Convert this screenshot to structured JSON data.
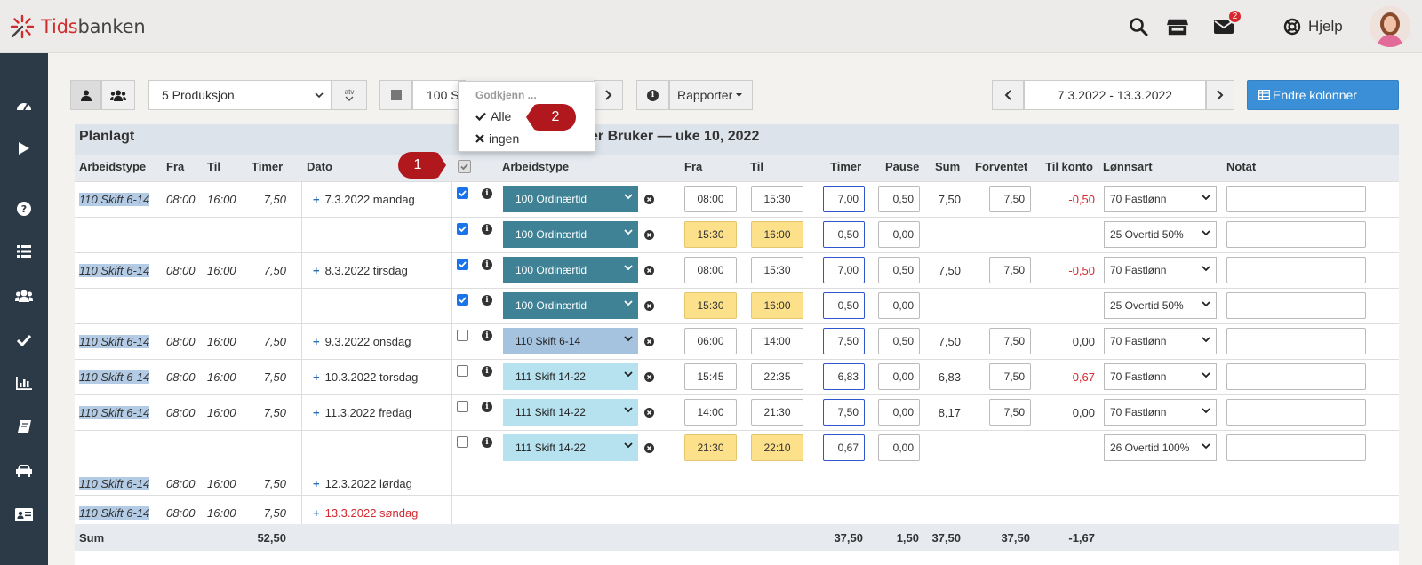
{
  "brand": {
    "name_part1": "Tids",
    "name_part2": "banken"
  },
  "topbar": {
    "help_label": "Hjelp",
    "mail_badge": "2"
  },
  "toolbar": {
    "department": "5 Produksjon",
    "attest": "atv",
    "employee_partial": "100 S",
    "reports": "Rapporter",
    "date_range": "7.3.2022 - 13.3.2022",
    "change_columns": "Endre kolonner"
  },
  "dropdown": {
    "header": "Godkjenn ...",
    "all": "Alle",
    "none": "ingen"
  },
  "callouts": {
    "one": "1",
    "two": "2"
  },
  "planned": {
    "title": "Planlagt",
    "headers": {
      "type": "Arbeidstype",
      "from": "Fra",
      "to": "Til",
      "hours": "Timer",
      "date": "Dato"
    }
  },
  "actual": {
    "title_suffix": "er Bruker — uke 10, 2022",
    "headers": {
      "type": "Arbeidstype",
      "from": "Fra",
      "to": "Til",
      "hours": "Timer",
      "pause": "Pause",
      "sum": "Sum",
      "expected": "Forventet",
      "account": "Til konto",
      "salary": "Lønnsart",
      "note": "Notat"
    }
  },
  "planned_rows": [
    {
      "type": "110 Skift 6-14",
      "from": "08:00",
      "to": "16:00",
      "hours": "7,50",
      "date": "7.3.2022 mandag"
    },
    {
      "type": "110 Skift 6-14",
      "from": "08:00",
      "to": "16:00",
      "hours": "7,50",
      "date": "8.3.2022 tirsdag"
    },
    {
      "type": "110 Skift 6-14",
      "from": "08:00",
      "to": "16:00",
      "hours": "7,50",
      "date": "9.3.2022 onsdag"
    },
    {
      "type": "110 Skift 6-14",
      "from": "08:00",
      "to": "16:00",
      "hours": "7,50",
      "date": "10.3.2022 torsdag"
    },
    {
      "type": "110 Skift 6-14",
      "from": "08:00",
      "to": "16:00",
      "hours": "7,50",
      "date": "11.3.2022 fredag"
    },
    {
      "type": "110 Skift 6-14",
      "from": "08:00",
      "to": "16:00",
      "hours": "7,50",
      "date": "12.3.2022 lørdag"
    },
    {
      "type": "110 Skift 6-14",
      "from": "08:00",
      "to": "16:00",
      "hours": "7,50",
      "date": "13.3.2022 søndag"
    }
  ],
  "actual_rows": [
    {
      "checked": true,
      "type": "100 Ordinærtid",
      "from": "08:00",
      "to": "15:30",
      "hours": "7,00",
      "pause": "0,50",
      "sum": "7,50",
      "expected": "7,50",
      "account": "-0,50",
      "salary": "70 Fastlønn"
    },
    {
      "checked": true,
      "type": "100 Ordinærtid",
      "from": "15:30",
      "to": "16:00",
      "hours": "0,50",
      "pause": "0,00",
      "sum": "",
      "expected": "",
      "account": "",
      "salary": "25 Overtid 50%"
    },
    {
      "checked": true,
      "type": "100 Ordinærtid",
      "from": "08:00",
      "to": "15:30",
      "hours": "7,00",
      "pause": "0,50",
      "sum": "7,50",
      "expected": "7,50",
      "account": "-0,50",
      "salary": "70 Fastlønn"
    },
    {
      "checked": true,
      "type": "100 Ordinærtid",
      "from": "15:30",
      "to": "16:00",
      "hours": "0,50",
      "pause": "0,00",
      "sum": "",
      "expected": "",
      "account": "",
      "salary": "25 Overtid 50%"
    },
    {
      "checked": false,
      "type": "110 Skift 6-14",
      "from": "06:00",
      "to": "14:00",
      "hours": "7,50",
      "pause": "0,50",
      "sum": "7,50",
      "expected": "7,50",
      "account": "0,00",
      "salary": "70 Fastlønn"
    },
    {
      "checked": false,
      "type": "111 Skift 14-22",
      "from": "15:45",
      "to": "22:35",
      "hours": "6,83",
      "pause": "0,00",
      "sum": "6,83",
      "expected": "7,50",
      "account": "-0,67",
      "salary": "70 Fastlønn"
    },
    {
      "checked": false,
      "type": "111 Skift 14-22",
      "from": "14:00",
      "to": "21:30",
      "hours": "7,50",
      "pause": "0,00",
      "sum": "8,17",
      "expected": "7,50",
      "account": "0,00",
      "salary": "70 Fastlønn"
    },
    {
      "checked": false,
      "type": "111 Skift 14-22",
      "from": "21:30",
      "to": "22:10",
      "hours": "0,67",
      "pause": "0,00",
      "sum": "",
      "expected": "",
      "account": "",
      "salary": "26 Overtid 100%"
    }
  ],
  "totals": {
    "label": "Sum",
    "planned_hours": "52,50",
    "hours": "37,50",
    "pause": "1,50",
    "sum": "37,50",
    "expected": "37,50",
    "account": "-1,67"
  }
}
